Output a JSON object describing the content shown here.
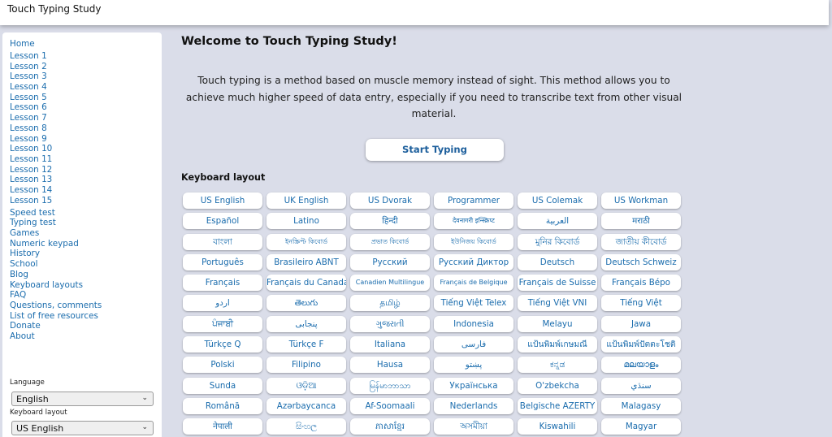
{
  "app": {
    "title": "Touch Typing Study"
  },
  "sidebar": {
    "nav": [
      "Home",
      "Lesson 1",
      "Lesson 2",
      "Lesson 3",
      "Lesson 4",
      "Lesson 5",
      "Lesson 6",
      "Lesson 7",
      "Lesson 8",
      "Lesson 9",
      "Lesson 10",
      "Lesson 11",
      "Lesson 12",
      "Lesson 13",
      "Lesson 14",
      "Lesson 15",
      "Speed test",
      "Typing test",
      "Games",
      "Numeric keypad",
      "History",
      "School",
      "Blog",
      "Keyboard layouts",
      "FAQ",
      "Questions, comments",
      "List of free resources",
      "Donate",
      "About"
    ],
    "language_label": "Language",
    "language_value": "English",
    "keyboard_layout_label": "Keyboard layout",
    "keyboard_layout_value": "US English"
  },
  "main": {
    "welcome": "Welcome to Touch Typing Study!",
    "intro": "Touch typing is a method based on muscle memory instead of sight. This method allows you to achieve much higher speed of data entry, especially if you need to transcribe text from other visual material.",
    "start_button": "Start Typing",
    "layout_heading": "Keyboard layout",
    "layouts": [
      "US English",
      "UK English",
      "US Dvorak",
      "Programmer",
      "US Colemak",
      "US Workman",
      "Español",
      "Latino",
      "हिन्दी",
      "देवनागरी इन्स्क्रिप्ट",
      "العربية",
      "मराठी",
      "বাংলা",
      "ইনস্ক্রিপ্ট কিবোর্ড",
      "প্রভাত কিবোর্ড",
      "ইউনিজয় কিবোর্ড",
      "মুনির কিবোর্ড",
      "জাতীয় কীবোর্ড",
      "Português",
      "Brasileiro ABNT",
      "Русский",
      "Русский Диктор",
      "Deutsch",
      "Deutsch Schweiz",
      "Français",
      "Français du Canada",
      "Canadien Multilingue",
      "Français de Belgique",
      "Français de Suisse",
      "Français Bépo",
      "اردو",
      "తెలుగు",
      "தமிழ்",
      "Tiếng Việt Telex",
      "Tiếng Việt VNI",
      "Tiếng Việt",
      "ਪੰਜਾਬੀ",
      "پنجابی",
      "ગુજરાતી",
      "Indonesia",
      "Melayu",
      "Jawa",
      "Türkçe Q",
      "Türkçe F",
      "Italiana",
      "فارسی",
      "แป้นพิมพ์เกษมณี",
      "แป้นพิมพ์ปัตตะโชติ",
      "Polski",
      "Filipino",
      "Hausa",
      "پښتو",
      "ಕನ್ನಡ",
      "മലയാളം",
      "Sunda",
      "ଓଡ଼ିଆ",
      "မြန်မာဘာသာ",
      "Українська",
      "O'zbekcha",
      "سنڌي",
      "Română",
      "Azərbaycanca",
      "Af-Soomaali",
      "Nederlands",
      "Belgische AZERTY",
      "Malagasy",
      "नेपाली",
      "සිංහල",
      "ភាសាខ្មែរ",
      "অসমীয়া",
      "Kiswahili",
      "Magyar"
    ]
  },
  "colors": {
    "link": "#1a6cad",
    "background": "#dadde9",
    "panel": "#ffffff"
  }
}
